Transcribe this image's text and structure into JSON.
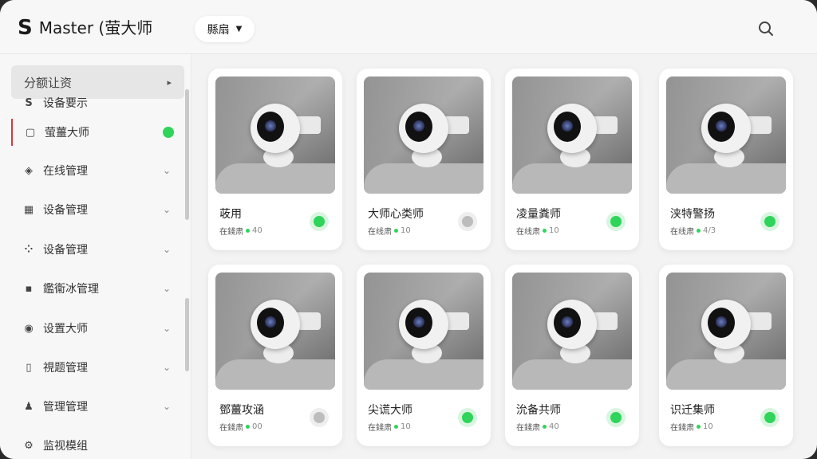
{
  "app": {
    "logo_mark": "S",
    "title": "Master (萤大师"
  },
  "header": {
    "filter_label": "縣扇",
    "search_icon": "search-icon"
  },
  "sidebar": {
    "head_label": "分额让资",
    "items": [
      {
        "label": "设备要示",
        "icon": "S",
        "chevron": false,
        "active": false,
        "dot": false
      },
      {
        "label": "萤薑大师",
        "icon": "▢",
        "chevron": false,
        "active": true,
        "dot": true
      },
      {
        "label": "在线管理",
        "icon": "◈",
        "chevron": true,
        "active": false,
        "dot": false
      },
      {
        "label": "设备管理",
        "icon": "▦",
        "chevron": true,
        "active": false,
        "dot": false
      },
      {
        "label": "设备管理",
        "icon": "⁘",
        "chevron": true,
        "active": false,
        "dot": false
      },
      {
        "label": "鑑衞冰管理",
        "icon": "▪",
        "chevron": true,
        "active": false,
        "dot": false
      },
      {
        "label": "设置大师",
        "icon": "◉",
        "chevron": true,
        "active": false,
        "dot": false
      },
      {
        "label": "視题管理",
        "icon": "▯",
        "chevron": true,
        "active": false,
        "dot": false
      },
      {
        "label": "管理管理",
        "icon": "♟",
        "chevron": true,
        "active": false,
        "dot": false
      },
      {
        "label": "监视模组",
        "icon": "⚙",
        "chevron": false,
        "active": false,
        "dot": false
      }
    ]
  },
  "cards": [
    {
      "name": "荍用",
      "status_text": "在錢肃",
      "count": "40",
      "online": true
    },
    {
      "name": "大师心类师",
      "status_text": "在线肃",
      "count": "10",
      "online": false
    },
    {
      "name": "凌量粪师",
      "status_text": "在线肃",
      "count": "10",
      "online": true
    },
    {
      "name": "浃特警扬",
      "status_text": "在线肃",
      "count": "4/3",
      "online": true
    },
    {
      "name": "鄧薑攻涵",
      "status_text": "在錢肃",
      "count": "00",
      "online": false
    },
    {
      "name": "尖谎大师",
      "status_text": "在錢肃",
      "count": "10",
      "online": true
    },
    {
      "name": "沇备共师",
      "status_text": "在錢肃",
      "count": "40",
      "online": true
    },
    {
      "name": "识迁集师",
      "status_text": "在錢肃",
      "count": "10",
      "online": true
    }
  ],
  "colors": {
    "accent_green": "#2fd45a",
    "active_marker": "#d23a3a"
  }
}
